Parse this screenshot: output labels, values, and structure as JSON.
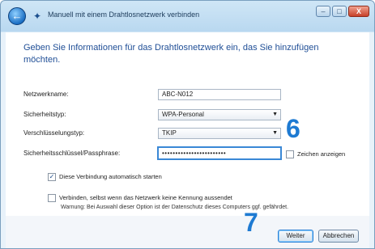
{
  "window": {
    "title": "Manuell mit einem Drahtlosnetzwerk verbinden",
    "controls": {
      "minimize": "–",
      "maximize": "□",
      "close": "X"
    }
  },
  "form": {
    "heading": "Geben Sie Informationen für das Drahtlosnetzwerk ein, das Sie hinzufügen möchten.",
    "network_name_label": "Netzwerkname:",
    "network_name_value": "ABC-N012",
    "security_type_label": "Sicherheitstyp:",
    "security_type_value": "WPA-Personal",
    "encryption_type_label": "Verschlüsselungstyp:",
    "encryption_type_value": "TKIP",
    "security_key_label": "Sicherheitsschlüssel/Passphrase:",
    "security_key_value": "••••••••••••••••••••••••",
    "show_chars_label": "Zeichen anzeigen",
    "auto_start_label": "Diese Verbindung automatisch starten",
    "connect_hidden_label": "Verbinden, selbst wenn das Netzwerk keine Kennung aussendet",
    "warning_text": "Warnung: Bei Auswahl dieser Option ist der Datenschutz dieses Computers ggf. gefährdet."
  },
  "buttons": {
    "next_label": "Weiter",
    "cancel_label": "Abbrechen"
  },
  "annotations": {
    "step6": "6",
    "step7": "7"
  }
}
